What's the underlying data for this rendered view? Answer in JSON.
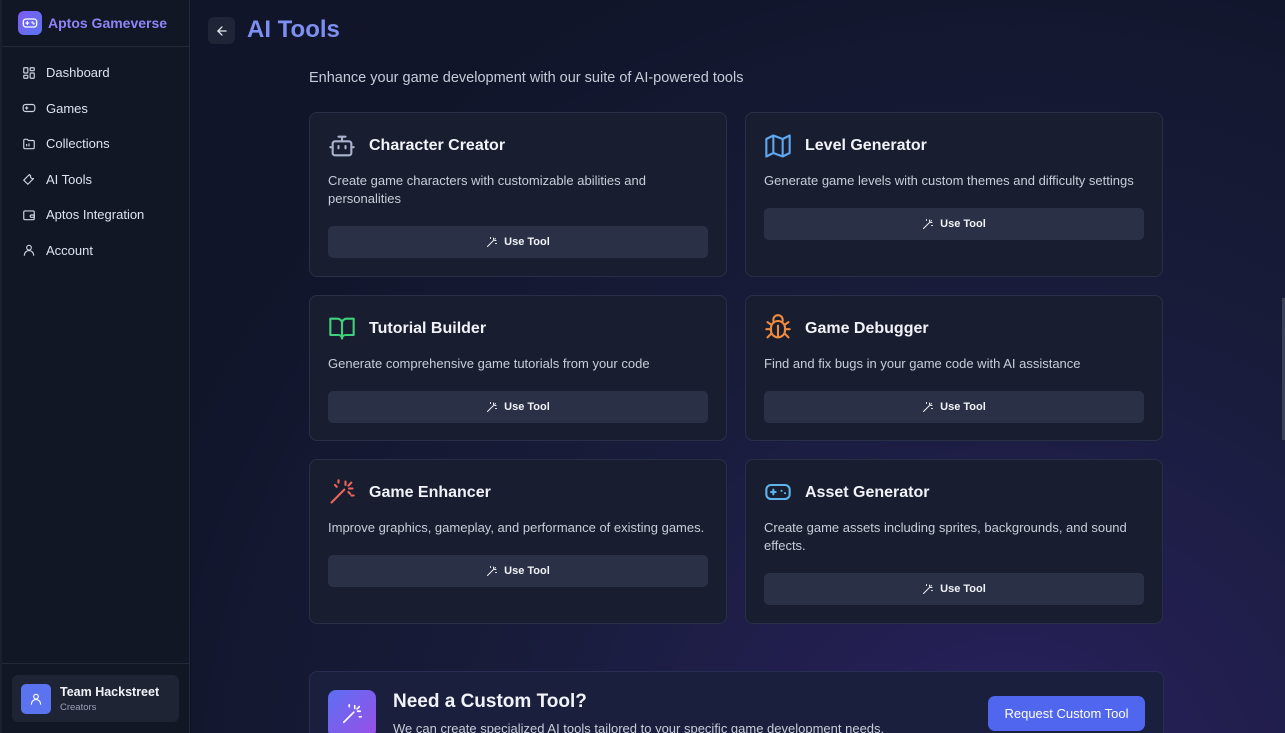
{
  "brand": {
    "name": "Aptos Gameverse"
  },
  "sidebar": {
    "items": [
      {
        "label": "Dashboard",
        "icon": "grid-icon"
      },
      {
        "label": "Games",
        "icon": "gamepad-icon"
      },
      {
        "label": "Collections",
        "icon": "folder-icon"
      },
      {
        "label": "AI Tools",
        "icon": "wrench-icon"
      },
      {
        "label": "Aptos Integration",
        "icon": "wallet-icon"
      },
      {
        "label": "Account",
        "icon": "user-icon"
      }
    ],
    "team": {
      "name": "Team Hackstreet",
      "role": "Creators"
    }
  },
  "header": {
    "title": "AI Tools",
    "subtitle": "Enhance your game development with our suite of AI-powered tools"
  },
  "tools": [
    {
      "title": "Character Creator",
      "description": "Create game characters with customizable abilities and personalities",
      "button": "Use Tool",
      "icon": "robot-icon",
      "color": "#a9b3cc"
    },
    {
      "title": "Level Generator",
      "description": "Generate game levels with custom themes and difficulty settings",
      "button": "Use Tool",
      "icon": "map-icon",
      "color": "#5fa7ee"
    },
    {
      "title": "Tutorial Builder",
      "description": "Generate comprehensive game tutorials from your code",
      "button": "Use Tool",
      "icon": "book-icon",
      "color": "#3fd07a"
    },
    {
      "title": "Game Debugger",
      "description": "Find and fix bugs in your game code with AI assistance",
      "button": "Use Tool",
      "icon": "bug-icon",
      "color": "#f08a3c"
    },
    {
      "title": "Game Enhancer",
      "description": "Improve graphics, gameplay, and performance of existing games.",
      "button": "Use Tool",
      "icon": "wand-sparkle-icon",
      "color": "#f0645a"
    },
    {
      "title": "Asset Generator",
      "description": "Create game assets including sprites, backgrounds, and sound effects.",
      "button": "Use Tool",
      "icon": "gamepad-icon",
      "color": "#5fb4ee"
    }
  ],
  "custom": {
    "title": "Need a Custom Tool?",
    "description": "We can create specialized AI tools tailored to your specific game development needs.",
    "button": "Request Custom Tool"
  }
}
